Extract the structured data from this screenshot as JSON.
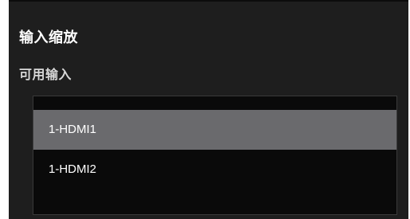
{
  "panel": {
    "title": "输入缩放",
    "available_inputs_label": "可用输入"
  },
  "inputs": [
    {
      "label": "1-HDMI1",
      "selected": true
    },
    {
      "label": "1-HDMI2",
      "selected": false
    }
  ],
  "colors": {
    "panel_bg": "#1e1e1e",
    "list_bg": "#0a0a0a",
    "selected_bg": "#6a6a6d",
    "text": "#ffffff"
  }
}
